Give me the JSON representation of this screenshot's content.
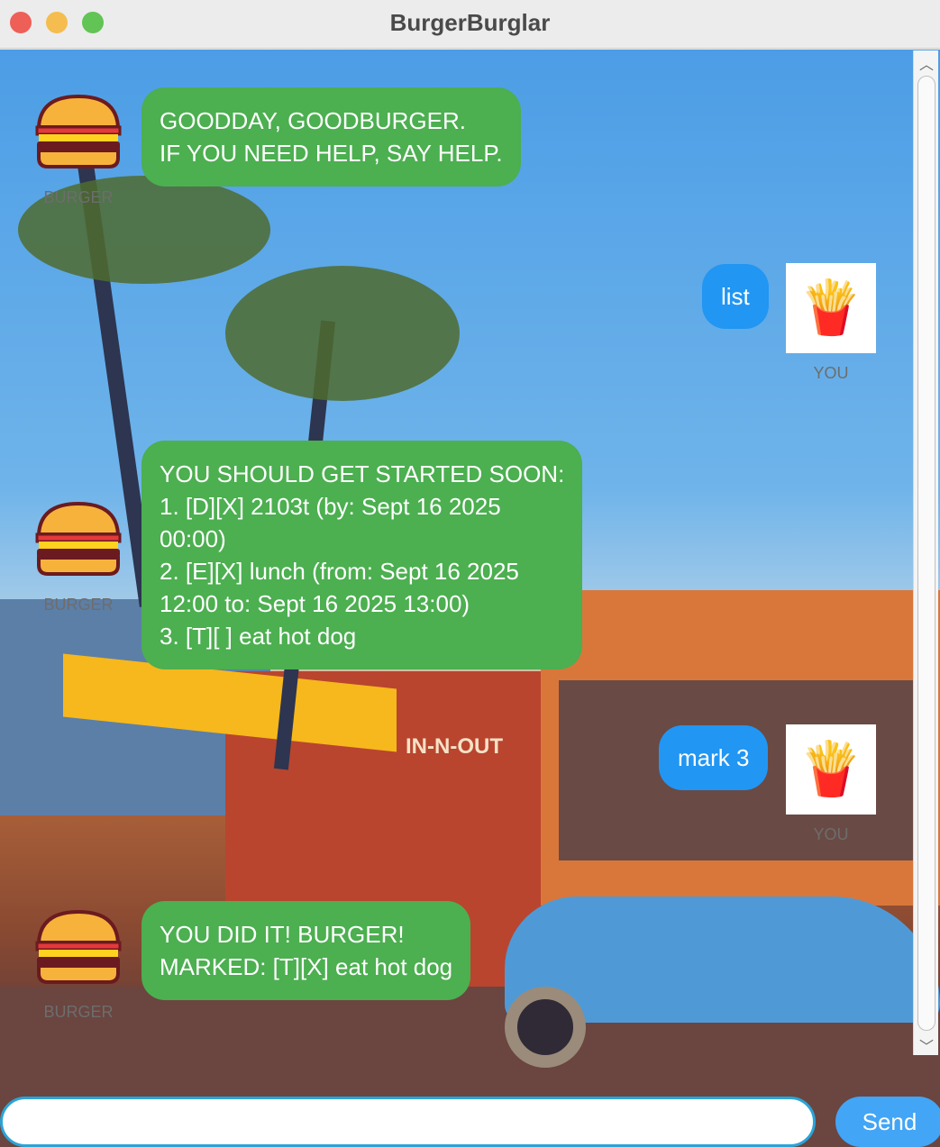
{
  "window": {
    "title": "BurgerBurglar"
  },
  "messages": [
    {
      "sender": "bot",
      "label": "BURGER",
      "text": "GOODDAY, GOODBURGER.\nIF YOU NEED HELP, SAY HELP."
    },
    {
      "sender": "user",
      "label": "YOU",
      "text": "list"
    },
    {
      "sender": "bot",
      "label": "BURGER",
      "text": "YOU SHOULD GET STARTED SOON:\n1. [D][X] 2103t (by: Sept 16 2025\n00:00)\n2. [E][X] lunch (from: Sept 16 2025\n12:00 to: Sept 16 2025 13:00)\n3. [T][ ] eat hot dog"
    },
    {
      "sender": "user",
      "label": "YOU",
      "text": "mark 3"
    },
    {
      "sender": "bot",
      "label": "BURGER",
      "text": "YOU DID IT! BURGER!\nMARKED: [T][X] eat hot dog"
    }
  ],
  "background_sign": "IN-N-OUT",
  "input": {
    "value": "",
    "placeholder": ""
  },
  "send_label": "Send",
  "colors": {
    "bot_bubble": "#4caf50",
    "user_bubble": "#2196f3",
    "send": "#42a5f5"
  }
}
